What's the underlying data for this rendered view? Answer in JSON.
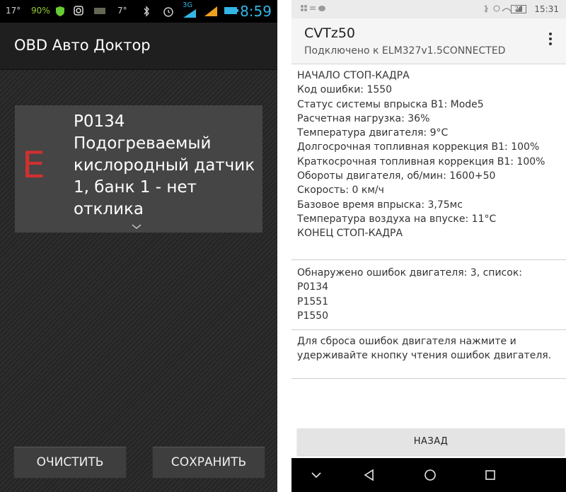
{
  "left_screen": {
    "status_bar": {
      "items": [
        "17°",
        "90%",
        "7°",
        "3G"
      ],
      "time": "8:59"
    },
    "app_title": "OBD Авто Доктор",
    "error_card": {
      "letter": "E",
      "code": "P0134",
      "description": "Подогреваемый кислородный датчик 1, банк 1 - нет отклика"
    },
    "buttons": {
      "clear": "ОЧИСТИТЬ",
      "save": "СОХРАНИТЬ"
    }
  },
  "right_screen": {
    "status_bar": {
      "battery": "20",
      "time": "15:31"
    },
    "app_bar": {
      "title": "CVTz50",
      "subtitle": "Подключено к ELM327v1.5CONNECTED"
    },
    "freeze_frame": [
      "НАЧАЛО СТОП-КАДРА",
      "Код ошибки: 1550",
      "Статус системы впрыска B1: Mode5",
      "Расчетная нагрузка: 36%",
      "Температура двигателя: 9°C",
      "Долгосрочная топливная коррекция B1: 100%",
      "Краткосрочная топливная коррекция B1: 100%",
      "Обороты двигателя, об/мин: 1600+50",
      "Скорость: 0 км/ч",
      "Базовое время впрыска: 3,75мс",
      "Температура воздуха на впуске: 11°C",
      "КОНЕЦ СТОП-КАДРА"
    ],
    "errors_found": [
      "Обнаружено ошибок двигателя: 3, список:",
      "P0134",
      "P1551",
      "P1550"
    ],
    "reset_hint": "Для сброса ошибок двигателя нажмите и удерживайте кнопку чтения ошибок двигателя.",
    "back_button": "НАЗАД"
  },
  "colors": {
    "left_bg": "#2a2a2a",
    "error_letter": "#d03030",
    "status_time": "#33b5e5"
  }
}
